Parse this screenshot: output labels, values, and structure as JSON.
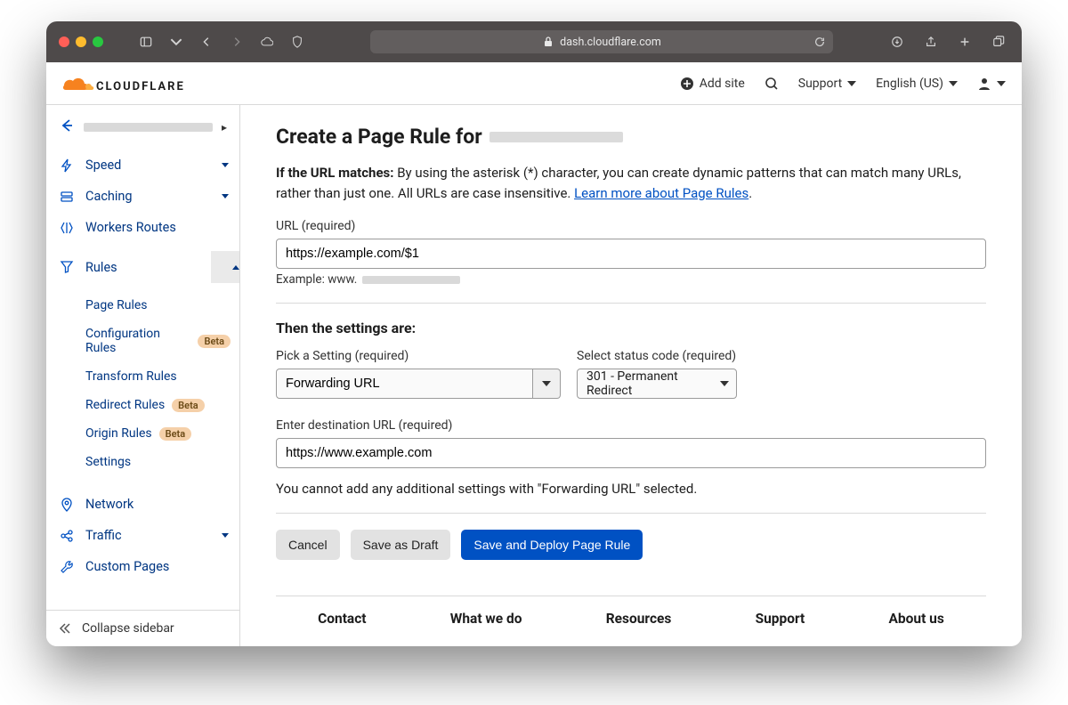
{
  "browser": {
    "url_host": "dash.cloudflare.com"
  },
  "header": {
    "logo_text": "CLOUDFLARE",
    "add_site": "Add site",
    "support": "Support",
    "language": "English (US)"
  },
  "sidebar": {
    "items": [
      {
        "label": "Speed",
        "icon": "bolt",
        "expandable": true
      },
      {
        "label": "Caching",
        "icon": "drive",
        "expandable": true
      },
      {
        "label": "Workers Routes",
        "icon": "workers",
        "expandable": false
      },
      {
        "label": "Rules",
        "icon": "funnel",
        "expandable": true,
        "expanded": true
      }
    ],
    "rules_sub": [
      {
        "label": "Page Rules"
      },
      {
        "label": "Configuration Rules",
        "badge": "Beta"
      },
      {
        "label": "Transform Rules"
      },
      {
        "label": "Redirect Rules",
        "badge": "Beta"
      },
      {
        "label": "Origin Rules",
        "badge": "Beta"
      },
      {
        "label": "Settings"
      }
    ],
    "items_after": [
      {
        "label": "Network",
        "icon": "pin",
        "expandable": false
      },
      {
        "label": "Traffic",
        "icon": "share",
        "expandable": true
      },
      {
        "label": "Custom Pages",
        "icon": "wrench",
        "expandable": false
      }
    ],
    "collapse": "Collapse sidebar"
  },
  "page": {
    "title_prefix": "Create a Page Rule for",
    "intro_bold": "If the URL matches:",
    "intro_rest": " By using the asterisk (*) character, you can create dynamic patterns that can match many URLs, rather than just one. All URLs are case insensitive. ",
    "intro_link": "Learn more about Page Rules",
    "url_label": "URL (required)",
    "url_value": "https://example.com/$1",
    "example_prefix": "Example: www.",
    "settings_header": "Then the settings are:",
    "pick_setting_label": "Pick a Setting (required)",
    "pick_setting_value": "Forwarding URL",
    "status_label": "Select status code (required)",
    "status_value": "301 - Permanent Redirect",
    "dest_label": "Enter destination URL (required)",
    "dest_value": "https://www.example.com",
    "note": "You cannot add any additional settings with \"Forwarding URL\" selected.",
    "cancel": "Cancel",
    "draft": "Save as Draft",
    "deploy": "Save and Deploy Page Rule"
  },
  "footer": {
    "cols": [
      "Contact",
      "What we do",
      "Resources",
      "Support",
      "About us"
    ]
  }
}
